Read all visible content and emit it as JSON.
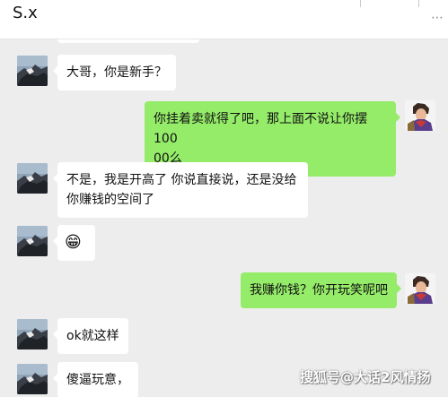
{
  "header": {
    "title": "S.x",
    "more": "⋯"
  },
  "colors": {
    "background": "#ededed",
    "incoming_bubble": "#ffffff",
    "outgoing_bubble": "#95ec69"
  },
  "messages": [
    {
      "side": "in",
      "text": "大哥，你是新手？"
    },
    {
      "side": "out",
      "line1": "你挂着卖就得了吧，那上面不说让你摆100",
      "line2": "00么"
    },
    {
      "side": "in",
      "line1": "不是，我是开高了 你说直接说，还是没给",
      "line2": "你赚钱的空间了"
    },
    {
      "side": "in",
      "text": "😁"
    },
    {
      "side": "out",
      "text": "我赚你钱？你开玩笑呢吧"
    },
    {
      "side": "in",
      "text": "ok就这样"
    },
    {
      "side": "in",
      "text": "傻逼玩意，"
    }
  ],
  "watermark": "搜狐号@大话2风情扬"
}
